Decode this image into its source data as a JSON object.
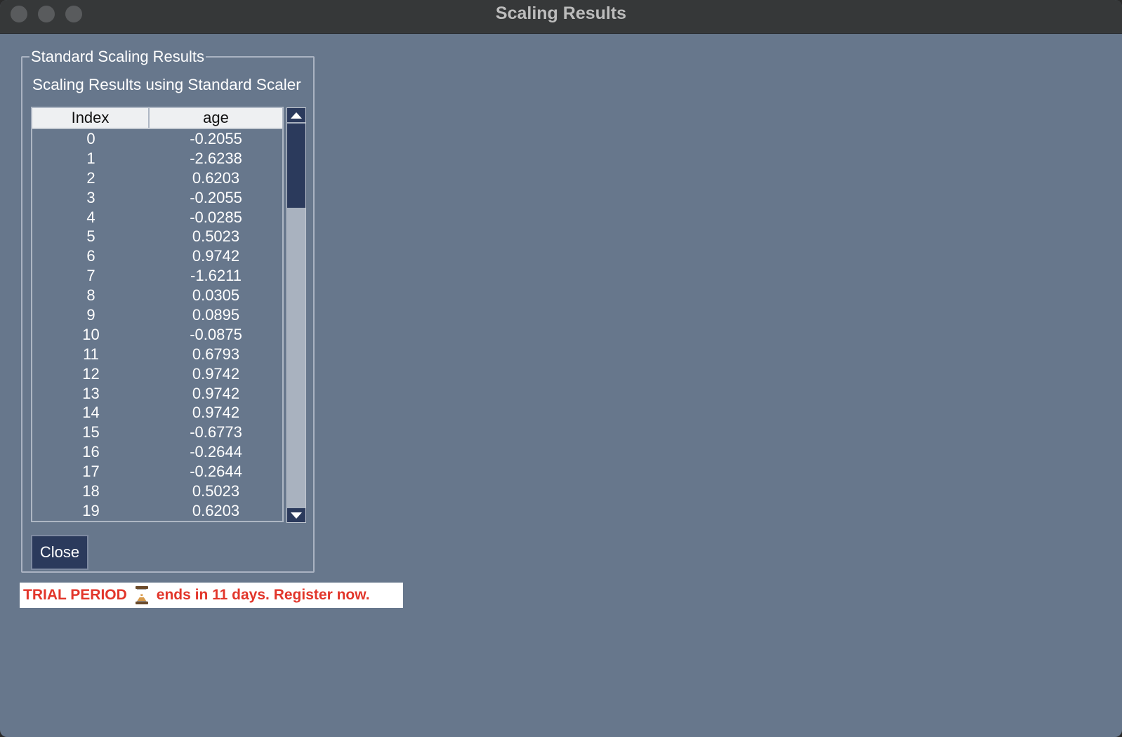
{
  "window": {
    "title": "Scaling Results"
  },
  "group": {
    "legend": "Standard Scaling Results",
    "subtitle": "Scaling Results using Standard Scaler"
  },
  "table": {
    "columns": [
      "Index",
      "age"
    ],
    "rows": [
      [
        "0",
        "-0.2055"
      ],
      [
        "1",
        "-2.6238"
      ],
      [
        "2",
        "0.6203"
      ],
      [
        "3",
        "-0.2055"
      ],
      [
        "4",
        "-0.0285"
      ],
      [
        "5",
        "0.5023"
      ],
      [
        "6",
        "0.9742"
      ],
      [
        "7",
        "-1.6211"
      ],
      [
        "8",
        "0.0305"
      ],
      [
        "9",
        "0.0895"
      ],
      [
        "10",
        "-0.0875"
      ],
      [
        "11",
        "0.6793"
      ],
      [
        "12",
        "0.9742"
      ],
      [
        "13",
        "0.9742"
      ],
      [
        "14",
        "0.9742"
      ],
      [
        "15",
        "-0.6773"
      ],
      [
        "16",
        "-0.2644"
      ],
      [
        "17",
        "-0.2644"
      ],
      [
        "18",
        "0.5023"
      ],
      [
        "19",
        "0.6203"
      ]
    ]
  },
  "buttons": {
    "close_label": "Close"
  },
  "trial": {
    "prefix": "TRIAL PERIOD",
    "icon": "hourglass-icon",
    "suffix": "ends in 11 days. Register now.",
    "color": "#e2362b"
  },
  "colors": {
    "window_bg": "#67778c",
    "titlebar_bg": "#363839",
    "accent_dark": "#2b3a5c"
  }
}
